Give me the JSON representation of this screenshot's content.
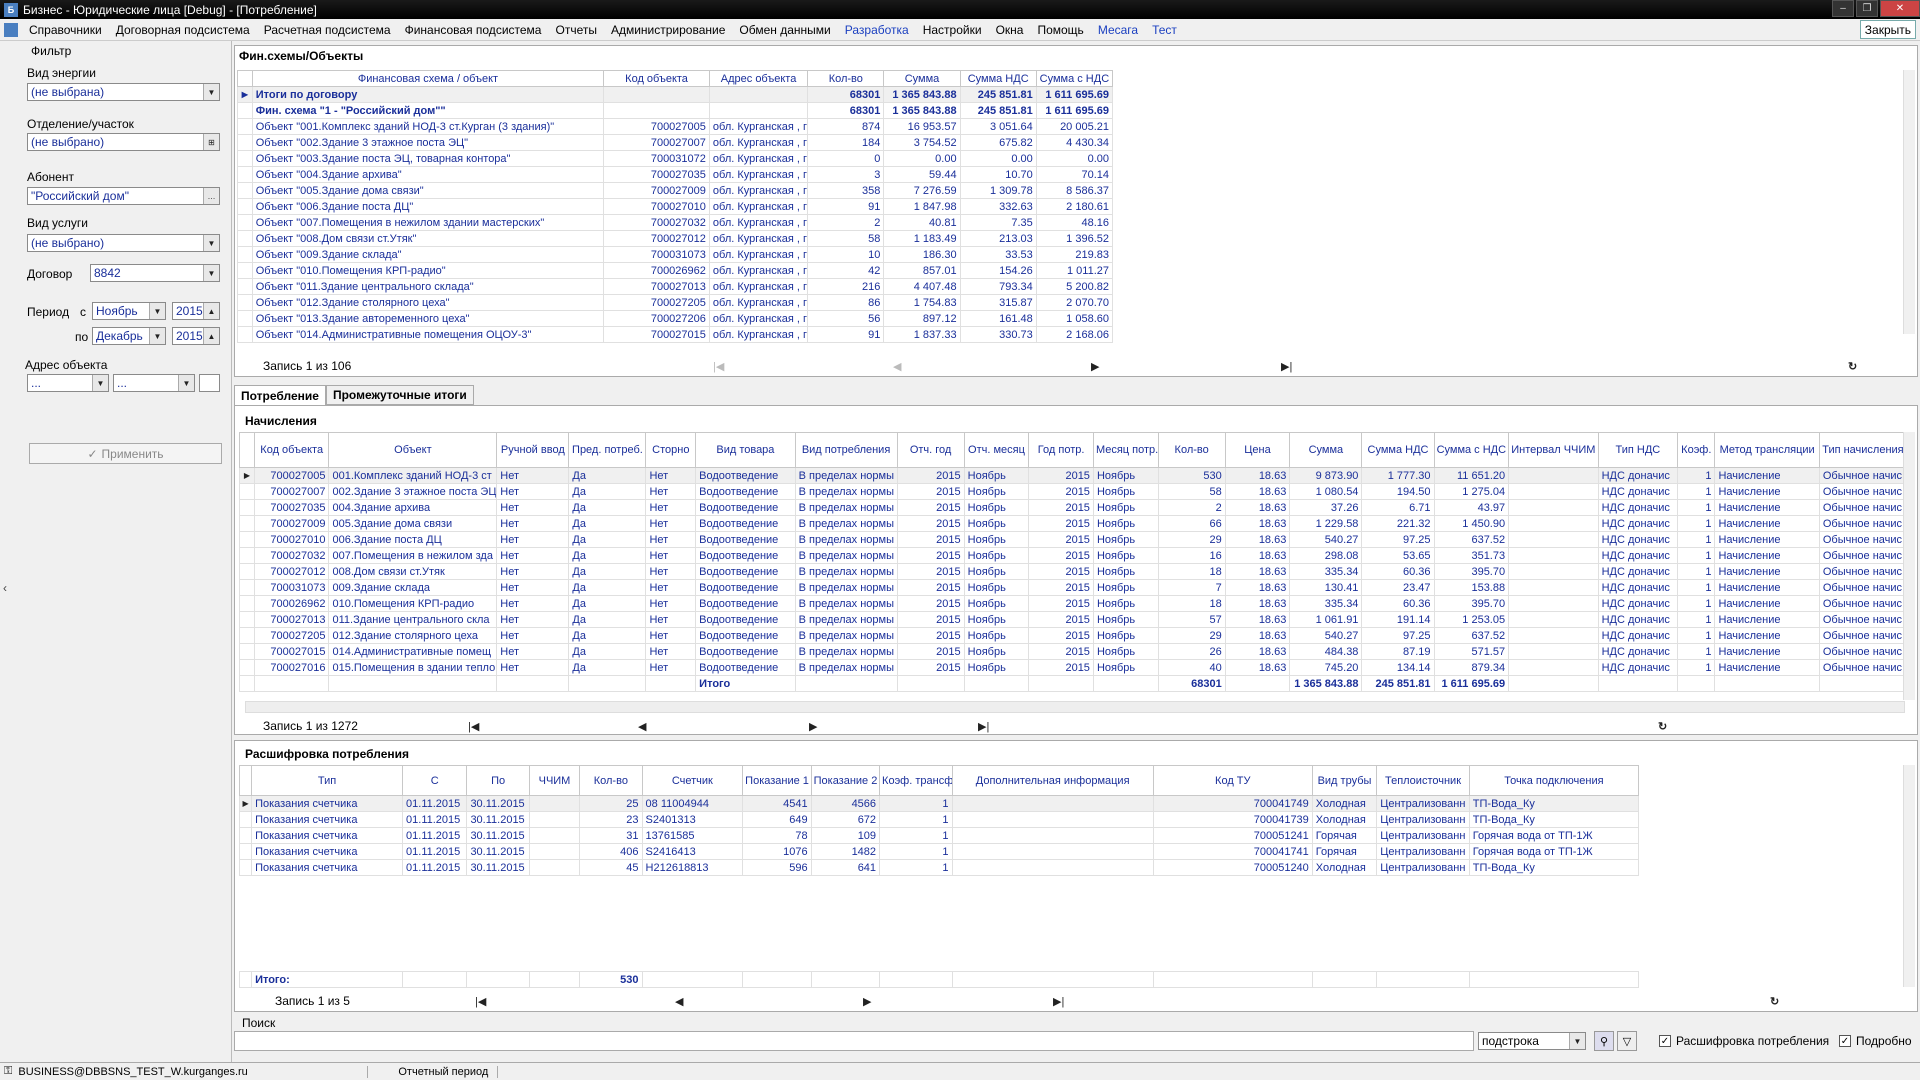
{
  "window": {
    "title": "Бизнес - Юридические лица [Debug] - [Потребление]",
    "close_tab": "Закрыть",
    "min": "–",
    "max": "❐",
    "close": "✕"
  },
  "menu": [
    {
      "label": "Справочники",
      "blue": false
    },
    {
      "label": "Договорная подсистема",
      "blue": false
    },
    {
      "label": "Расчетная подсистема",
      "blue": false
    },
    {
      "label": "Финансовая подсистема",
      "blue": false
    },
    {
      "label": "Отчеты",
      "blue": false
    },
    {
      "label": "Администрирование",
      "blue": false
    },
    {
      "label": "Обмен данными",
      "blue": false
    },
    {
      "label": "Разработка",
      "blue": true
    },
    {
      "label": "Настройки",
      "blue": false
    },
    {
      "label": "Окна",
      "blue": false
    },
    {
      "label": "Помощь",
      "blue": false
    },
    {
      "label": "Месага",
      "blue": true
    },
    {
      "label": "Тест",
      "blue": true
    }
  ],
  "filter": {
    "title": "Фильтр",
    "energy_label": "Вид энергии",
    "energy_value": "(не выбрана)",
    "dept_label": "Отделение/участок",
    "dept_value": "(не выбрано)",
    "subscriber_label": "Абонент",
    "subscriber_value": "\"Российский дом\"",
    "service_label": "Вид услуги",
    "service_value": "(не выбрано)",
    "contract_label": "Договор",
    "contract_value": "8842",
    "period_label": "Период",
    "from_label": "с",
    "to_label": "по",
    "from_month": "Ноябрь",
    "from_year": "2015",
    "to_month": "Декабрь",
    "to_year": "2015",
    "address_label": "Адрес объекта",
    "addr1": "...",
    "addr2": "...",
    "apply": "Применить"
  },
  "fin": {
    "title": "Фин.схемы/Объекты",
    "columns": [
      "Финансовая схема / объект",
      "Код объекта",
      "Адрес объекта",
      "Кол-во",
      "Сумма",
      "Сумма НДС",
      "Сумма с НДС"
    ],
    "rows": [
      [
        "Итоги по договору",
        "",
        "",
        "68301",
        "1 365 843.88",
        "245 851.81",
        "1 611 695.69"
      ],
      [
        "Фин. схема \"1 - \"Российский дом\"\"",
        "",
        "",
        "68301",
        "1 365 843.88",
        "245 851.81",
        "1 611 695.69"
      ],
      [
        "Объект \"001.Комплекс зданий НОД-3 ст.Курган (3 здания)\"",
        "700027005",
        "обл. Курганская , г",
        "874",
        "16 953.57",
        "3 051.64",
        "20 005.21"
      ],
      [
        "Объект \"002.Здание 3 этажное поста ЭЦ\"",
        "700027007",
        "обл. Курганская , г",
        "184",
        "3 754.52",
        "675.82",
        "4 430.34"
      ],
      [
        "Объект \"003.Здание поста ЭЦ, товарная контора\"",
        "700031072",
        "обл. Курганская , г",
        "0",
        "0.00",
        "0.00",
        "0.00"
      ],
      [
        "Объект \"004.Здание архива\"",
        "700027035",
        "обл. Курганская , г",
        "3",
        "59.44",
        "10.70",
        "70.14"
      ],
      [
        "Объект \"005.Здание дома связи\"",
        "700027009",
        "обл. Курганская , г",
        "358",
        "7 276.59",
        "1 309.78",
        "8 586.37"
      ],
      [
        "Объект \"006.Здание поста ДЦ\"",
        "700027010",
        "обл. Курганская , г",
        "91",
        "1 847.98",
        "332.63",
        "2 180.61"
      ],
      [
        "Объект \"007.Помещения в нежилом здании мастерских\"",
        "700027032",
        "обл. Курганская , г",
        "2",
        "40.81",
        "7.35",
        "48.16"
      ],
      [
        "Объект \"008.Дом связи ст.Утяк\"",
        "700027012",
        "обл. Курганская , г",
        "58",
        "1 183.49",
        "213.03",
        "1 396.52"
      ],
      [
        "Объект \"009.Здание склада\"",
        "700031073",
        "обл. Курганская , г",
        "10",
        "186.30",
        "33.53",
        "219.83"
      ],
      [
        "Объект \"010.Помещения КРП-радио\"",
        "700026962",
        "обл. Курганская , г",
        "42",
        "857.01",
        "154.26",
        "1 011.27"
      ],
      [
        "Объект \"011.Здание центрального склада\"",
        "700027013",
        "обл. Курганская , г",
        "216",
        "4 407.48",
        "793.34",
        "5 200.82"
      ],
      [
        "Объект \"012.Здание столярного цеха\"",
        "700027205",
        "обл. Курганская , г",
        "86",
        "1 754.83",
        "315.87",
        "2 070.70"
      ],
      [
        "Объект \"013.Здание автоременного цеха\"",
        "700027206",
        "обл. Курганская , г",
        "56",
        "897.12",
        "161.48",
        "1 058.60"
      ],
      [
        "Объект \"014.Административные помещения ОЦОУ-3\"",
        "700027015",
        "обл. Курганская , г",
        "91",
        "1 837.33",
        "330.73",
        "2 168.06"
      ]
    ],
    "record": "Запись 1 из 106"
  },
  "tabs": [
    "Потребление",
    "Промежуточные итоги"
  ],
  "charges": {
    "title": "Начисления",
    "columns": [
      "Код объекта",
      "Объект",
      "Ручной ввод",
      "Пред. потреб.",
      "Сторно",
      "Вид товара",
      "Вид потребления",
      "Отч. год",
      "Отч. месяц",
      "Год потр.",
      "Месяц потр.",
      "Кол-во",
      "Цена",
      "Сумма",
      "Сумма НДС",
      "Сумма с НДС",
      "Интервал ЧЧИМ",
      "Тип НДС",
      "Коэф.",
      "Метод трансляции",
      "Тип начисления"
    ],
    "rows": [
      [
        "700027005",
        "001.Комплекс зданий НОД-3 ст",
        "Нет",
        "Да",
        "Нет",
        "Водоотведение",
        "В пределах нормы",
        "2015",
        "Ноябрь",
        "2015",
        "Ноябрь",
        "530",
        "18.63",
        "9 873.90",
        "1 777.30",
        "11 651.20",
        "",
        "НДС доначис",
        "1",
        "Начисление",
        "Обычное начис"
      ],
      [
        "700027007",
        "002.Здание 3 этажное поста ЭЦ",
        "Нет",
        "Да",
        "Нет",
        "Водоотведение",
        "В пределах нормы",
        "2015",
        "Ноябрь",
        "2015",
        "Ноябрь",
        "58",
        "18.63",
        "1 080.54",
        "194.50",
        "1 275.04",
        "",
        "НДС доначис",
        "1",
        "Начисление",
        "Обычное начис"
      ],
      [
        "700027035",
        "004.Здание архива",
        "Нет",
        "Да",
        "Нет",
        "Водоотведение",
        "В пределах нормы",
        "2015",
        "Ноябрь",
        "2015",
        "Ноябрь",
        "2",
        "18.63",
        "37.26",
        "6.71",
        "43.97",
        "",
        "НДС доначис",
        "1",
        "Начисление",
        "Обычное начис"
      ],
      [
        "700027009",
        "005.Здание дома связи",
        "Нет",
        "Да",
        "Нет",
        "Водоотведение",
        "В пределах нормы",
        "2015",
        "Ноябрь",
        "2015",
        "Ноябрь",
        "66",
        "18.63",
        "1 229.58",
        "221.32",
        "1 450.90",
        "",
        "НДС доначис",
        "1",
        "Начисление",
        "Обычное начис"
      ],
      [
        "700027010",
        "006.Здание поста ДЦ",
        "Нет",
        "Да",
        "Нет",
        "Водоотведение",
        "В пределах нормы",
        "2015",
        "Ноябрь",
        "2015",
        "Ноябрь",
        "29",
        "18.63",
        "540.27",
        "97.25",
        "637.52",
        "",
        "НДС доначис",
        "1",
        "Начисление",
        "Обычное начис"
      ],
      [
        "700027032",
        "007.Помещения в нежилом зда",
        "Нет",
        "Да",
        "Нет",
        "Водоотведение",
        "В пределах нормы",
        "2015",
        "Ноябрь",
        "2015",
        "Ноябрь",
        "16",
        "18.63",
        "298.08",
        "53.65",
        "351.73",
        "",
        "НДС доначис",
        "1",
        "Начисление",
        "Обычное начис"
      ],
      [
        "700027012",
        "008.Дом связи ст.Утяк",
        "Нет",
        "Да",
        "Нет",
        "Водоотведение",
        "В пределах нормы",
        "2015",
        "Ноябрь",
        "2015",
        "Ноябрь",
        "18",
        "18.63",
        "335.34",
        "60.36",
        "395.70",
        "",
        "НДС доначис",
        "1",
        "Начисление",
        "Обычное начис"
      ],
      [
        "700031073",
        "009.Здание склада",
        "Нет",
        "Да",
        "Нет",
        "Водоотведение",
        "В пределах нормы",
        "2015",
        "Ноябрь",
        "2015",
        "Ноябрь",
        "7",
        "18.63",
        "130.41",
        "23.47",
        "153.88",
        "",
        "НДС доначис",
        "1",
        "Начисление",
        "Обычное начис"
      ],
      [
        "700026962",
        "010.Помещения КРП-радио",
        "Нет",
        "Да",
        "Нет",
        "Водоотведение",
        "В пределах нормы",
        "2015",
        "Ноябрь",
        "2015",
        "Ноябрь",
        "18",
        "18.63",
        "335.34",
        "60.36",
        "395.70",
        "",
        "НДС доначис",
        "1",
        "Начисление",
        "Обычное начис"
      ],
      [
        "700027013",
        "011.Здание центрального скла",
        "Нет",
        "Да",
        "Нет",
        "Водоотведение",
        "В пределах нормы",
        "2015",
        "Ноябрь",
        "2015",
        "Ноябрь",
        "57",
        "18.63",
        "1 061.91",
        "191.14",
        "1 253.05",
        "",
        "НДС доначис",
        "1",
        "Начисление",
        "Обычное начис"
      ],
      [
        "700027205",
        "012.Здание столярного цеха",
        "Нет",
        "Да",
        "Нет",
        "Водоотведение",
        "В пределах нормы",
        "2015",
        "Ноябрь",
        "2015",
        "Ноябрь",
        "29",
        "18.63",
        "540.27",
        "97.25",
        "637.52",
        "",
        "НДС доначис",
        "1",
        "Начисление",
        "Обычное начис"
      ],
      [
        "700027015",
        "014.Административные помещ",
        "Нет",
        "Да",
        "Нет",
        "Водоотведение",
        "В пределах нормы",
        "2015",
        "Ноябрь",
        "2015",
        "Ноябрь",
        "26",
        "18.63",
        "484.38",
        "87.19",
        "571.57",
        "",
        "НДС доначис",
        "1",
        "Начисление",
        "Обычное начис"
      ],
      [
        "700027016",
        "015.Помещения в здании тепло",
        "Нет",
        "Да",
        "Нет",
        "Водоотведение",
        "В пределах нормы",
        "2015",
        "Ноябрь",
        "2015",
        "Ноябрь",
        "40",
        "18.63",
        "745.20",
        "134.14",
        "879.34",
        "",
        "НДС доначис",
        "1",
        "Начисление",
        "Обычное начис"
      ]
    ],
    "total_label": "Итого",
    "total_qty": "68301",
    "total_sum": "1 365 843.88",
    "total_nds": "245 851.81",
    "total_with_nds": "1 611 695.69",
    "record": "Запись 1 из 1272"
  },
  "decode": {
    "title": "Расшифровка потребления",
    "columns": [
      "Тип",
      "С",
      "По",
      "ЧЧИМ",
      "Кол-во",
      "Счетчик",
      "Показание 1",
      "Показание 2",
      "Коэф. трансф.",
      "Дополнительная информация",
      "Код ТУ",
      "Вид трубы",
      "Теплоисточник",
      "Точка подключения"
    ],
    "rows": [
      [
        "Показания счетчика",
        "01.11.2015",
        "30.11.2015",
        "",
        "25",
        "08 11004944",
        "4541",
        "4566",
        "1",
        "",
        "700041749",
        "Холодная",
        "Централизованн",
        "ТП-Вода_Ку"
      ],
      [
        "Показания счетчика",
        "01.11.2015",
        "30.11.2015",
        "",
        "23",
        "S2401313",
        "649",
        "672",
        "1",
        "",
        "700041739",
        "Холодная",
        "Централизованн",
        "ТП-Вода_Ку"
      ],
      [
        "Показания счетчика",
        "01.11.2015",
        "30.11.2015",
        "",
        "31",
        "13761585",
        "78",
        "109",
        "1",
        "",
        "700051241",
        "Горячая",
        "Централизованн",
        "Горячая вода от ТП-1Ж"
      ],
      [
        "Показания счетчика",
        "01.11.2015",
        "30.11.2015",
        "",
        "406",
        "S2416413",
        "1076",
        "1482",
        "1",
        "",
        "700041741",
        "Горячая",
        "Централизованн",
        "Горячая вода от ТП-1Ж"
      ],
      [
        "Показания счетчика",
        "01.11.2015",
        "30.11.2015",
        "",
        "45",
        "H212618813",
        "596",
        "641",
        "1",
        "",
        "700051240",
        "Холодная",
        "Централизованн",
        "ТП-Вода_Ку"
      ]
    ],
    "total_label": "Итого:",
    "total_qty": "530",
    "record": "Запись 1 из 5"
  },
  "nav": {
    "first": "|◀",
    "prev": "◀",
    "next": "▶",
    "last": "▶|",
    "refresh": "↻"
  },
  "search": {
    "label": "Поиск",
    "mode": "подстрока",
    "decode_chk": "Расшифровка потребления",
    "detail_chk": "Подробно"
  },
  "status": {
    "user": "BUSINESS@DBBSNS_TEST_W.kurganges.ru",
    "period": "Отчетный период"
  }
}
